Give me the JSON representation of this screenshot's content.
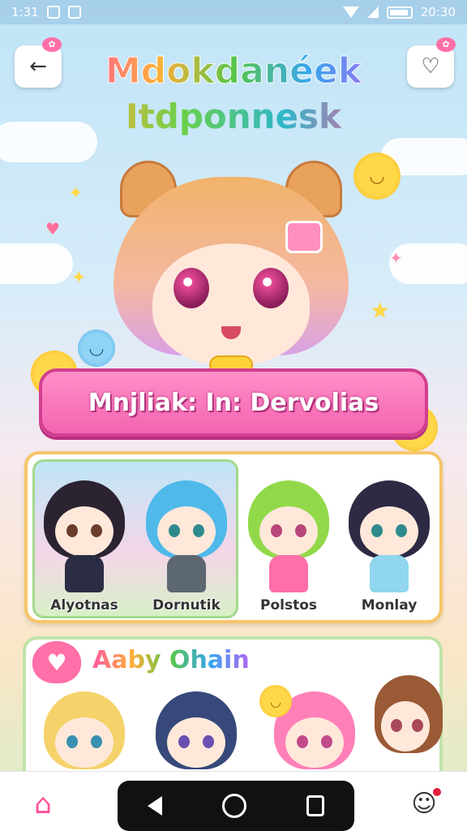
{
  "status_bar": {
    "time": "1:31",
    "clock": "20:30"
  },
  "header": {
    "back_icon": "back-arrow-icon",
    "right_icon": "heart-outline-icon",
    "title_line1": "Mdokdanéek",
    "title_line2": "Itdponnesk"
  },
  "banner": {
    "label": "Mnjliak: In: Dervolias"
  },
  "characters": {
    "featured": [
      {
        "name": "Alyotnas"
      },
      {
        "name": "Dornutik"
      }
    ],
    "others": [
      {
        "name": "Polstos"
      },
      {
        "name": "Monlay"
      }
    ]
  },
  "friends": {
    "title": "Aaby Ohain"
  },
  "bottom_nav": {
    "home_icon": "home-icon",
    "profile_icon": "friends-icon"
  },
  "colors": {
    "accent_pink": "#f464b0",
    "panel_border_yellow": "#f7c56a",
    "panel_border_green": "#bfe3a8"
  }
}
